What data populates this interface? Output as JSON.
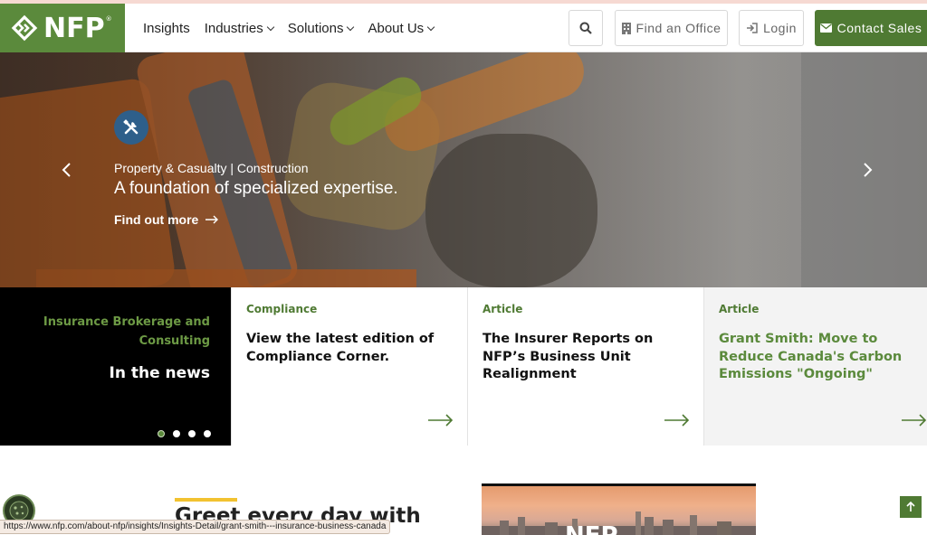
{
  "header": {
    "logo_text": "NFP",
    "logo_reg": "®",
    "nav": [
      {
        "label": "Insights"
      },
      {
        "label": "Industries"
      },
      {
        "label": "Solutions"
      },
      {
        "label": "About Us"
      }
    ],
    "find_office": "Find an Office",
    "login": "Login",
    "contact": "Contact Sales"
  },
  "hero": {
    "kicker": "Property & Casualty | Construction",
    "title": "A foundation of specialized expertise.",
    "link": "Find out more"
  },
  "news": {
    "kicker": "Insurance Brokerage and Consulting",
    "title": "In the news",
    "slides": 4,
    "active_slide": 1
  },
  "cards": [
    {
      "tag": "Compliance",
      "title": "View the latest edition of Compliance Corner."
    },
    {
      "tag": "Article",
      "title": "The Insurer Reports on NFP’s Business Unit Realignment"
    },
    {
      "tag": "Article",
      "title": "Grant Smith: Move to Reduce Canada's Carbon Emissions \"Ongoing\""
    }
  ],
  "lower": {
    "title": "Greet every day with",
    "promo_logo": "NFP"
  },
  "status_url": "https://www.nfp.com/about-nfp/insights/Insights-Detail/grant-smith---insurance-business-canada",
  "colors": {
    "brand_green": "#5b8a3c",
    "dark_green": "#4f7a33",
    "news_bg": "#000000",
    "accent_yellow": "#f2c230",
    "icon_blue": "#2e5f8a"
  },
  "icons": {
    "search": "search-icon",
    "office": "building-icon",
    "login": "sign-in-icon",
    "contact": "envelope-icon",
    "hero": "tools-icon"
  }
}
